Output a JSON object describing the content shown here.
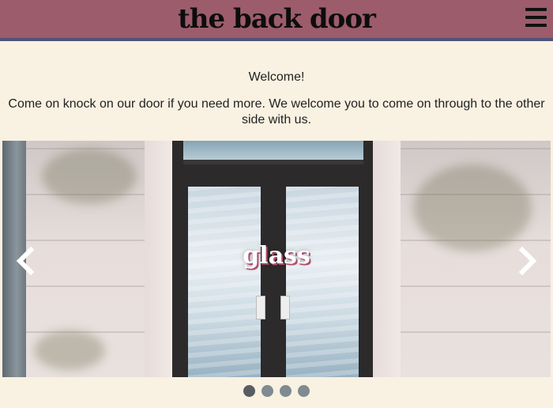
{
  "header": {
    "title": "the back door",
    "menu_icon": "hamburger-icon",
    "background": "#9c5c6c",
    "border": "#4e5377"
  },
  "main": {
    "welcome": "Welcome!",
    "intro": "Come on knock on our door if you need more. We welcome you to come on through to the other side with us."
  },
  "carousel": {
    "caption": "glass",
    "prev_icon": "chevron-left-icon",
    "next_icon": "chevron-right-icon",
    "slide_count": 4,
    "active_index": 0
  },
  "colors": {
    "page_background": "#f9f1e1",
    "caption_shadow": "#b24c6a"
  }
}
